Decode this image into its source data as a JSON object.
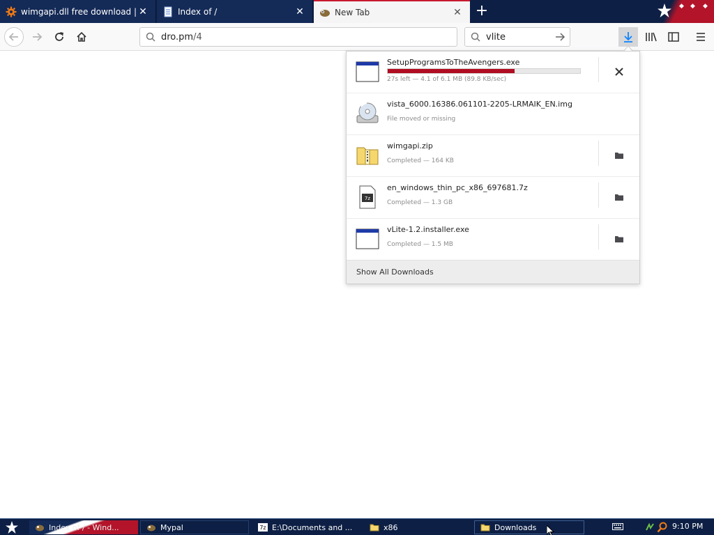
{
  "tabs": [
    {
      "label": "wimgapi.dll free download | DLL-fil",
      "favicon": "gear-orange-icon",
      "active": false
    },
    {
      "label": "Index of /",
      "favicon": "document-icon",
      "active": false
    },
    {
      "label": "New Tab",
      "favicon": "firefox-icon",
      "active": true
    }
  ],
  "navbar": {
    "url_host": "dro.pm",
    "url_path": "/4",
    "search_value": "vlite"
  },
  "downloads": {
    "items": [
      {
        "name": "SetupProgramsToTheAvengers.exe",
        "status": "27s left — 4.1 of 6.1 MB (89.8 KB/sec)",
        "progress": 0.66,
        "icon": "exe-window-icon",
        "action": "cancel-icon"
      },
      {
        "name": "vista_6000.16386.061101-2205-LRMAIK_EN.img",
        "status": "File moved or missing",
        "icon": "disc-image-icon",
        "action": null
      },
      {
        "name": "wimgapi.zip",
        "status": "Completed — 164 KB",
        "icon": "zip-folder-icon",
        "action": "folder-icon"
      },
      {
        "name": "en_windows_thin_pc_x86_697681.7z",
        "status": "Completed — 1.3 GB",
        "icon": "7z-archive-icon",
        "action": "folder-icon"
      },
      {
        "name": "vLite-1.2.installer.exe",
        "status": "Completed — 1.5 MB",
        "icon": "exe-window-icon",
        "action": "folder-icon"
      }
    ],
    "footer_label": "Show All Downloads"
  },
  "taskbar": {
    "items": [
      {
        "label": "Index of / - Wind...",
        "icon": "firefox-icon"
      },
      {
        "label": "Mypal",
        "icon": "mypal-icon"
      },
      {
        "label": "E:\\Documents and ...",
        "icon": "7zip-icon"
      },
      {
        "label": "x86",
        "icon": "folder-icon"
      },
      {
        "label": "Downloads",
        "icon": "folder-icon"
      }
    ],
    "clock": "9:10 PM"
  },
  "colors": {
    "accent_red": "#b00d22",
    "tab_bg": "#142a57",
    "taskbar_bg": "#0d1f44"
  }
}
